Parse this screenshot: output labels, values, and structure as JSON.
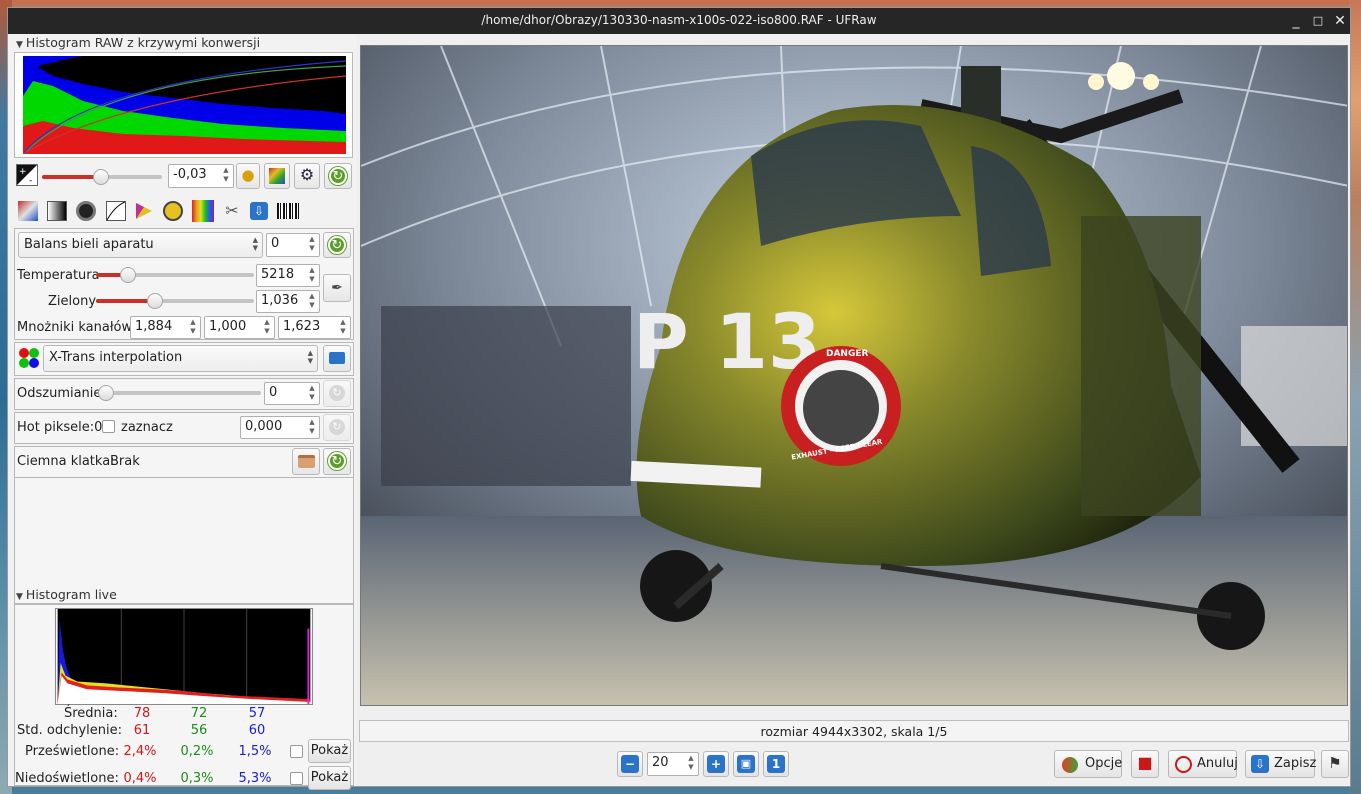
{
  "window": {
    "title": "/home/dhor/Obrazy/130330-nasm-x100s-022-iso800.RAF - UFRaw",
    "controls": [
      "_",
      "□",
      "✕"
    ]
  },
  "raw_histogram": {
    "header": "Histogram RAW z krzywymi konwersji"
  },
  "exposure": {
    "value": "-0,03",
    "slider_fraction": 0.49,
    "icons": [
      "exposure-compensation-icon",
      "auto-exposure-bulb-icon",
      "restore-details-icon",
      "clip-highlights-icon",
      "reset-icon"
    ]
  },
  "tabs": [
    "white-balance-tab",
    "grayscale-tab",
    "base-curve-tab",
    "luminosity-curve-tab",
    "color-management-tab",
    "corrections-tab",
    "lightness-adjustments-tab",
    "crop-rotate-tab",
    "save-tab",
    "exif-tab"
  ],
  "white_balance": {
    "preset": "Balans bieli aparatu",
    "fine_tune": "0",
    "temperature_label": "Temperatura",
    "temperature_value": "5218",
    "temperature_fraction": 0.17,
    "green_label": "Zielony",
    "green_value": "1,036",
    "green_fraction": 0.36,
    "multipliers_label": "Mnożniki kanałów:",
    "multipliers": [
      "1,884",
      "1,000",
      "1,623"
    ]
  },
  "interpolation": {
    "value": "X-Trans interpolation"
  },
  "denoise": {
    "label": "Odszumianie",
    "value": "0",
    "fraction": 0.0
  },
  "hot_pixels": {
    "label": "Hot piksele:0",
    "checkbox_label": "zaznacz",
    "value": "0,000"
  },
  "dark_frame": {
    "label": "Ciemna klatka:",
    "value": "Brak"
  },
  "live_histogram": {
    "header": "Histogram live",
    "mean_label": "Średnia:",
    "std_label": "Std. odchylenie:",
    "over_label": "Prześwietlone:",
    "under_label": "Niedoświetlone:",
    "mean": [
      "78",
      "72",
      "57"
    ],
    "std": [
      "61",
      "56",
      "60"
    ],
    "over": [
      "2,4%",
      "0,2%",
      "1,5%"
    ],
    "under": [
      "0,4%",
      "0,3%",
      "5,3%"
    ],
    "show_button": "Pokaż"
  },
  "status": {
    "text": "rozmiar 4944x3302, skala 1/5"
  },
  "zoom": {
    "value": "20"
  },
  "buttons": {
    "options": "Opcje",
    "cancel": "Anuluj",
    "save": "Zapisz"
  },
  "photo": {
    "nose_text": "P 13",
    "danger_text": "DANGER",
    "exhaust_text": "EXHAUST - KEEP CLEAR"
  },
  "colors": {
    "accent_green": "#5c9e2c",
    "slider_red": "#c9302c",
    "icon_blue": "#2a73c9"
  }
}
